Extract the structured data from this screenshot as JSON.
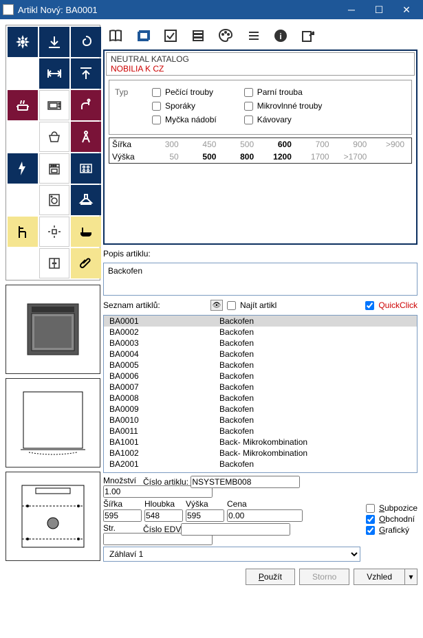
{
  "window": {
    "title": "Artikl Nový: BA0001"
  },
  "catalog": {
    "line1": "NEUTRAL KATALOG",
    "line2": "NOBILIA K CZ"
  },
  "typ": {
    "label": "Typ",
    "left": [
      "Pečící trouby",
      "Sporáky",
      "Myčka nádobí"
    ],
    "right": [
      "Parní trouba",
      "Mikrovlnné trouby",
      "Kávovary"
    ]
  },
  "dims_filter": {
    "rows": [
      {
        "label": "Šířka",
        "vals": [
          "300",
          "450",
          "500",
          "600",
          "700",
          "900",
          ">900"
        ],
        "selected": [
          3
        ]
      },
      {
        "label": "Výška",
        "vals": [
          "50",
          "500",
          "800",
          "1200",
          "1700",
          ">1700",
          ""
        ],
        "selected": [
          1,
          2,
          3
        ]
      }
    ]
  },
  "desc": {
    "label": "Popis artiklu:",
    "value": "Backofen"
  },
  "listhead": {
    "label": "Seznam artiklů:",
    "find": "Najít artikl",
    "quickclick": "QuickClick"
  },
  "articles": [
    {
      "code": "BA0001",
      "name": "Backofen",
      "sel": true
    },
    {
      "code": "BA0002",
      "name": "Backofen"
    },
    {
      "code": "BA0003",
      "name": "Backofen"
    },
    {
      "code": "BA0004",
      "name": "Backofen"
    },
    {
      "code": "BA0005",
      "name": "Backofen"
    },
    {
      "code": "BA0006",
      "name": "Backofen"
    },
    {
      "code": "BA0007",
      "name": "Backofen"
    },
    {
      "code": "BA0008",
      "name": "Backofen"
    },
    {
      "code": "BA0009",
      "name": "Backofen"
    },
    {
      "code": "BA0010",
      "name": "Backofen"
    },
    {
      "code": "BA0011",
      "name": "Backofen"
    },
    {
      "code": "BA1001",
      "name": "Back- Mikrokombination"
    },
    {
      "code": "BA1002",
      "name": "Back- Mikrokombination"
    },
    {
      "code": "BA2001",
      "name": "Backofen"
    }
  ],
  "form": {
    "qty_label": "Množství",
    "qty": "1.00",
    "artnum_label": "Číslo artiklu:",
    "artnum": "NSYSTEMB008",
    "w_label": "Šířka",
    "w": "595",
    "d_label": "Hloubka",
    "d": "548",
    "h_label": "Výška",
    "h": "595",
    "price_label": "Cena",
    "price": "0.00",
    "str_label": "Str.",
    "edv_label": "Číslo EDV",
    "sub_label": "Subpozice",
    "trade_label": "Obchodní",
    "graphic_label": "Grafický",
    "header_opt": "Záhlaví 1"
  },
  "buttons": {
    "use": "Použít",
    "cancel": "Storno",
    "look": "Vzhled"
  }
}
